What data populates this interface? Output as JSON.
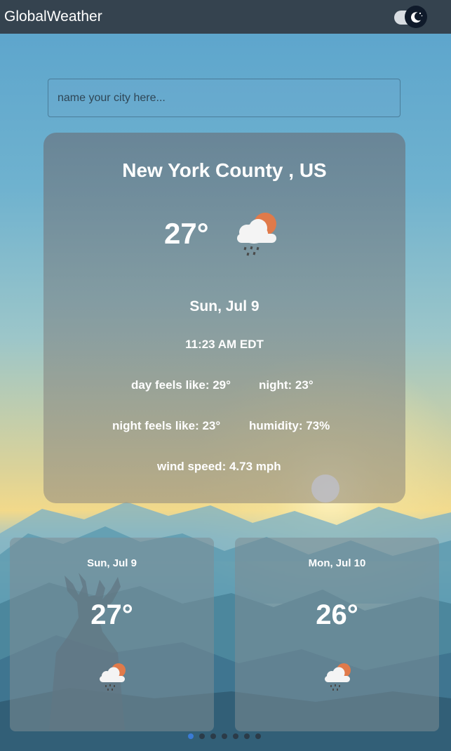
{
  "header": {
    "title": "GlobalWeather",
    "theme_toggle_icon": "moon-icon"
  },
  "search": {
    "placeholder": "name your city here..."
  },
  "current": {
    "location": "New York County , US",
    "temperature": "27°",
    "icon": "cloud-rain-sun-icon",
    "date": "Sun, Jul 9",
    "time": "11:23 AM EDT",
    "day_feels_like": "day feels like: 29°",
    "night": "night: 23°",
    "night_feels_like": "night feels like: 23°",
    "humidity": "humidity: 73%",
    "wind_speed": "wind speed: 4.73 mph"
  },
  "forecast": [
    {
      "date": "Sun, Jul 9",
      "temperature": "27°",
      "icon": "cloud-rain-sun-icon"
    },
    {
      "date": "Mon, Jul 10",
      "temperature": "26°",
      "icon": "cloud-rain-sun-icon"
    }
  ],
  "carousel": {
    "page_count": 7,
    "active_index": 0
  },
  "colors": {
    "topbar": "#35434f",
    "sun_orange": "#e07a4a",
    "active_dot": "#3a7bd5"
  }
}
